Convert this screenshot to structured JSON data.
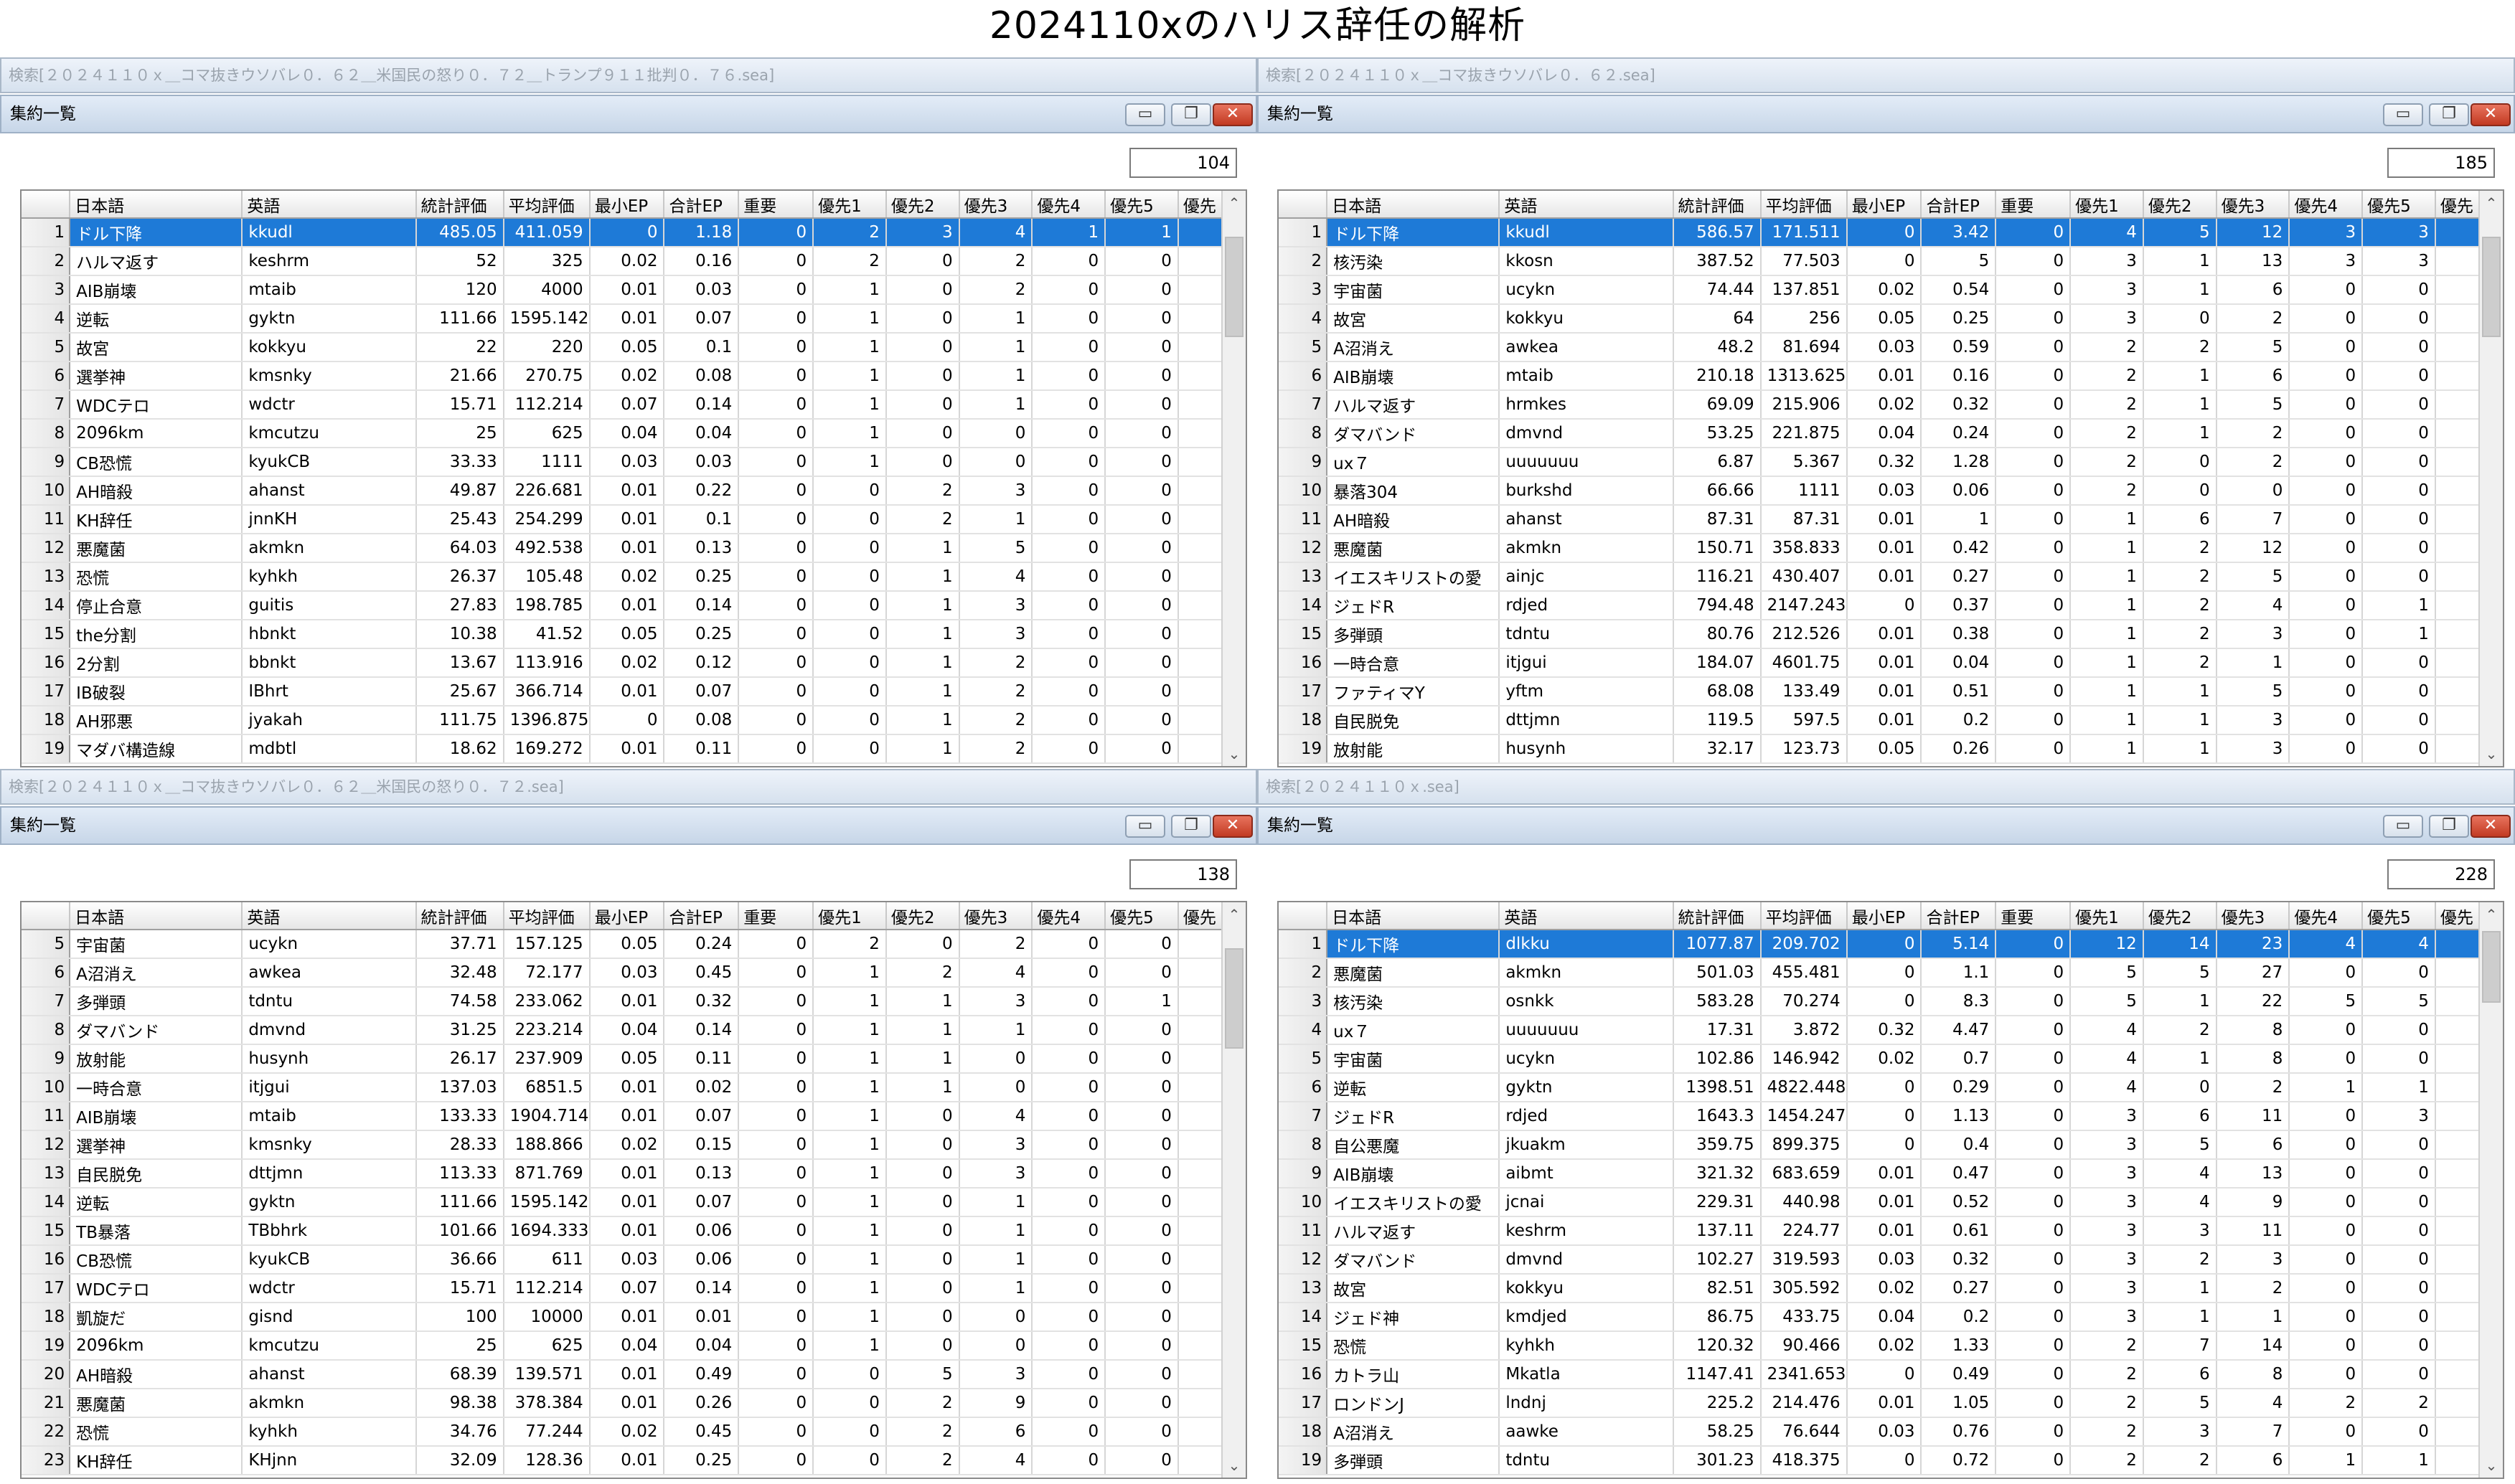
{
  "title": "2024110xのハリス辞任の解析",
  "columns": [
    "日本語",
    "英語",
    "統計評価",
    "平均評価",
    "最小EP",
    "合計EP",
    "重要",
    "優先1",
    "優先2",
    "優先3",
    "優先4",
    "優先5",
    "優先"
  ],
  "window_title": "集約一覧",
  "buttons": {
    "minimize": "▭",
    "restore": "❐",
    "close": "✕"
  },
  "scroll": {
    "up": "⌃",
    "down": "⌄"
  },
  "panes": [
    {
      "search": "検索[２０２４１１０ｘ＿コマ抜きウソバレ０．６２＿米国民の怒り０．７２＿トランプ９１１批判０．７６.sea]",
      "count": "104",
      "rows": [
        [
          "1",
          "ドル下降",
          "kkudl",
          "485.05",
          "411.059",
          "0",
          "1.18",
          "0",
          "2",
          "3",
          "4",
          "1",
          "1"
        ],
        [
          "2",
          "ハルマ返す",
          "keshrm",
          "52",
          "325",
          "0.02",
          "0.16",
          "0",
          "2",
          "0",
          "2",
          "0",
          "0"
        ],
        [
          "3",
          "AIB崩壊",
          "mtaib",
          "120",
          "4000",
          "0.01",
          "0.03",
          "0",
          "1",
          "0",
          "2",
          "0",
          "0"
        ],
        [
          "4",
          "逆転",
          "gyktn",
          "111.66",
          "1595.142",
          "0.01",
          "0.07",
          "0",
          "1",
          "0",
          "1",
          "0",
          "0"
        ],
        [
          "5",
          "故宮",
          "kokkyu",
          "22",
          "220",
          "0.05",
          "0.1",
          "0",
          "1",
          "0",
          "1",
          "0",
          "0"
        ],
        [
          "6",
          "選挙神",
          "kmsnky",
          "21.66",
          "270.75",
          "0.02",
          "0.08",
          "0",
          "1",
          "0",
          "1",
          "0",
          "0"
        ],
        [
          "7",
          "WDCテロ",
          "wdctr",
          "15.71",
          "112.214",
          "0.07",
          "0.14",
          "0",
          "1",
          "0",
          "1",
          "0",
          "0"
        ],
        [
          "8",
          "2096km",
          "kmcutzu",
          "25",
          "625",
          "0.04",
          "0.04",
          "0",
          "1",
          "0",
          "0",
          "0",
          "0"
        ],
        [
          "9",
          "CB恐慌",
          "kyukCB",
          "33.33",
          "1111",
          "0.03",
          "0.03",
          "0",
          "1",
          "0",
          "0",
          "0",
          "0"
        ],
        [
          "10",
          "AH暗殺",
          "ahanst",
          "49.87",
          "226.681",
          "0.01",
          "0.22",
          "0",
          "0",
          "2",
          "3",
          "0",
          "0"
        ],
        [
          "11",
          "KH辞任",
          "jnnKH",
          "25.43",
          "254.299",
          "0.01",
          "0.1",
          "0",
          "0",
          "2",
          "1",
          "0",
          "0"
        ],
        [
          "12",
          "悪魔菌",
          "akmkn",
          "64.03",
          "492.538",
          "0.01",
          "0.13",
          "0",
          "0",
          "1",
          "5",
          "0",
          "0"
        ],
        [
          "13",
          "恐慌",
          "kyhkh",
          "26.37",
          "105.48",
          "0.02",
          "0.25",
          "0",
          "0",
          "1",
          "4",
          "0",
          "0"
        ],
        [
          "14",
          "停止合意",
          "guitis",
          "27.83",
          "198.785",
          "0.01",
          "0.14",
          "0",
          "0",
          "1",
          "3",
          "0",
          "0"
        ],
        [
          "15",
          "the分割",
          "hbnkt",
          "10.38",
          "41.52",
          "0.05",
          "0.25",
          "0",
          "0",
          "1",
          "3",
          "0",
          "0"
        ],
        [
          "16",
          "2分割",
          "bbnkt",
          "13.67",
          "113.916",
          "0.02",
          "0.12",
          "0",
          "0",
          "1",
          "2",
          "0",
          "0"
        ],
        [
          "17",
          "IB破裂",
          "IBhrt",
          "25.67",
          "366.714",
          "0.01",
          "0.07",
          "0",
          "0",
          "1",
          "2",
          "0",
          "0"
        ],
        [
          "18",
          "AH邪悪",
          "jyakah",
          "111.75",
          "1396.875",
          "0",
          "0.08",
          "0",
          "0",
          "1",
          "2",
          "0",
          "0"
        ],
        [
          "19",
          "マダバ構造線",
          "mdbtl",
          "18.62",
          "169.272",
          "0.01",
          "0.11",
          "0",
          "0",
          "1",
          "2",
          "0",
          "0"
        ]
      ]
    },
    {
      "search": "検索[２０２４１１０ｘ＿コマ抜きウソバレ０．６２.sea]",
      "count": "185",
      "rows": [
        [
          "1",
          "ドル下降",
          "kkudl",
          "586.57",
          "171.511",
          "0",
          "3.42",
          "0",
          "4",
          "5",
          "12",
          "3",
          "3"
        ],
        [
          "2",
          "核汚染",
          "kkosn",
          "387.52",
          "77.503",
          "0",
          "5",
          "0",
          "3",
          "1",
          "13",
          "3",
          "3"
        ],
        [
          "3",
          "宇宙菌",
          "ucykn",
          "74.44",
          "137.851",
          "0.02",
          "0.54",
          "0",
          "3",
          "1",
          "6",
          "0",
          "0"
        ],
        [
          "4",
          "故宮",
          "kokkyu",
          "64",
          "256",
          "0.05",
          "0.25",
          "0",
          "3",
          "0",
          "2",
          "0",
          "0"
        ],
        [
          "5",
          "A沼消え",
          "awkea",
          "48.2",
          "81.694",
          "0.03",
          "0.59",
          "0",
          "2",
          "2",
          "5",
          "0",
          "0"
        ],
        [
          "6",
          "AIB崩壊",
          "mtaib",
          "210.18",
          "1313.625",
          "0.01",
          "0.16",
          "0",
          "2",
          "1",
          "6",
          "0",
          "0"
        ],
        [
          "7",
          "ハルマ返す",
          "hrmkes",
          "69.09",
          "215.906",
          "0.02",
          "0.32",
          "0",
          "2",
          "1",
          "5",
          "0",
          "0"
        ],
        [
          "8",
          "ダマバンド",
          "dmvnd",
          "53.25",
          "221.875",
          "0.04",
          "0.24",
          "0",
          "2",
          "1",
          "2",
          "0",
          "0"
        ],
        [
          "9",
          "ux７",
          "uuuuuuu",
          "6.87",
          "5.367",
          "0.32",
          "1.28",
          "0",
          "2",
          "0",
          "2",
          "0",
          "0"
        ],
        [
          "10",
          "暴落304",
          "burkshd",
          "66.66",
          "1111",
          "0.03",
          "0.06",
          "0",
          "2",
          "0",
          "0",
          "0",
          "0"
        ],
        [
          "11",
          "AH暗殺",
          "ahanst",
          "87.31",
          "87.31",
          "0.01",
          "1",
          "0",
          "1",
          "6",
          "7",
          "0",
          "0"
        ],
        [
          "12",
          "悪魔菌",
          "akmkn",
          "150.71",
          "358.833",
          "0.01",
          "0.42",
          "0",
          "1",
          "2",
          "12",
          "0",
          "0"
        ],
        [
          "13",
          "イエスキリストの愛",
          "ainjc",
          "116.21",
          "430.407",
          "0.01",
          "0.27",
          "0",
          "1",
          "2",
          "5",
          "0",
          "0"
        ],
        [
          "14",
          "ジェドR",
          "rdjed",
          "794.48",
          "2147.243",
          "0",
          "0.37",
          "0",
          "1",
          "2",
          "4",
          "0",
          "1"
        ],
        [
          "15",
          "多弾頭",
          "tdntu",
          "80.76",
          "212.526",
          "0.01",
          "0.38",
          "0",
          "1",
          "2",
          "3",
          "0",
          "1"
        ],
        [
          "16",
          "一時合意",
          "itjgui",
          "184.07",
          "4601.75",
          "0.01",
          "0.04",
          "0",
          "1",
          "2",
          "1",
          "0",
          "0"
        ],
        [
          "17",
          "ファティマY",
          "yftm",
          "68.08",
          "133.49",
          "0.01",
          "0.51",
          "0",
          "1",
          "1",
          "5",
          "0",
          "0"
        ],
        [
          "18",
          "自民脱免",
          "dttjmn",
          "119.5",
          "597.5",
          "0.01",
          "0.2",
          "0",
          "1",
          "1",
          "3",
          "0",
          "0"
        ],
        [
          "19",
          "放射能",
          "husynh",
          "32.17",
          "123.73",
          "0.05",
          "0.26",
          "0",
          "1",
          "1",
          "3",
          "0",
          "0"
        ]
      ]
    },
    {
      "search": "検索[２０２４１１０ｘ＿コマ抜きウソバレ０．６２＿米国民の怒り０．７２.sea]",
      "count": "138",
      "rows": [
        [
          "5",
          "宇宙菌",
          "ucykn",
          "37.71",
          "157.125",
          "0.05",
          "0.24",
          "0",
          "2",
          "0",
          "2",
          "0",
          "0"
        ],
        [
          "6",
          "A沼消え",
          "awkea",
          "32.48",
          "72.177",
          "0.03",
          "0.45",
          "0",
          "1",
          "2",
          "4",
          "0",
          "0"
        ],
        [
          "7",
          "多弾頭",
          "tdntu",
          "74.58",
          "233.062",
          "0.01",
          "0.32",
          "0",
          "1",
          "1",
          "3",
          "0",
          "1"
        ],
        [
          "8",
          "ダマバンド",
          "dmvnd",
          "31.25",
          "223.214",
          "0.04",
          "0.14",
          "0",
          "1",
          "1",
          "1",
          "0",
          "0"
        ],
        [
          "9",
          "放射能",
          "husynh",
          "26.17",
          "237.909",
          "0.05",
          "0.11",
          "0",
          "1",
          "1",
          "0",
          "0",
          "0"
        ],
        [
          "10",
          "一時合意",
          "itjgui",
          "137.03",
          "6851.5",
          "0.01",
          "0.02",
          "0",
          "1",
          "1",
          "0",
          "0",
          "0"
        ],
        [
          "11",
          "AIB崩壊",
          "mtaib",
          "133.33",
          "1904.714",
          "0.01",
          "0.07",
          "0",
          "1",
          "0",
          "4",
          "0",
          "0"
        ],
        [
          "12",
          "選挙神",
          "kmsnky",
          "28.33",
          "188.866",
          "0.02",
          "0.15",
          "0",
          "1",
          "0",
          "3",
          "0",
          "0"
        ],
        [
          "13",
          "自民脱免",
          "dttjmn",
          "113.33",
          "871.769",
          "0.01",
          "0.13",
          "0",
          "1",
          "0",
          "3",
          "0",
          "0"
        ],
        [
          "14",
          "逆転",
          "gyktn",
          "111.66",
          "1595.142",
          "0.01",
          "0.07",
          "0",
          "1",
          "0",
          "1",
          "0",
          "0"
        ],
        [
          "15",
          "TB暴落",
          "TBbhrk",
          "101.66",
          "1694.333",
          "0.01",
          "0.06",
          "0",
          "1",
          "0",
          "1",
          "0",
          "0"
        ],
        [
          "16",
          "CB恐慌",
          "kyukCB",
          "36.66",
          "611",
          "0.03",
          "0.06",
          "0",
          "1",
          "0",
          "1",
          "0",
          "0"
        ],
        [
          "17",
          "WDCテロ",
          "wdctr",
          "15.71",
          "112.214",
          "0.07",
          "0.14",
          "0",
          "1",
          "0",
          "1",
          "0",
          "0"
        ],
        [
          "18",
          "凱旋だ",
          "gisnd",
          "100",
          "10000",
          "0.01",
          "0.01",
          "0",
          "1",
          "0",
          "0",
          "0",
          "0"
        ],
        [
          "19",
          "2096km",
          "kmcutzu",
          "25",
          "625",
          "0.04",
          "0.04",
          "0",
          "1",
          "0",
          "0",
          "0",
          "0"
        ],
        [
          "20",
          "AH暗殺",
          "ahanst",
          "68.39",
          "139.571",
          "0.01",
          "0.49",
          "0",
          "0",
          "5",
          "3",
          "0",
          "0"
        ],
        [
          "21",
          "悪魔菌",
          "akmkn",
          "98.38",
          "378.384",
          "0.01",
          "0.26",
          "0",
          "0",
          "2",
          "9",
          "0",
          "0"
        ],
        [
          "22",
          "恐慌",
          "kyhkh",
          "34.76",
          "77.244",
          "0.02",
          "0.45",
          "0",
          "0",
          "2",
          "6",
          "0",
          "0"
        ],
        [
          "23",
          "KH辞任",
          "KHjnn",
          "32.09",
          "128.36",
          "0.01",
          "0.25",
          "0",
          "0",
          "2",
          "4",
          "0",
          "0"
        ]
      ]
    },
    {
      "search": "検索[２０２４１１０ｘ.sea]",
      "count": "228",
      "rows": [
        [
          "1",
          "ドル下降",
          "dlkku",
          "1077.87",
          "209.702",
          "0",
          "5.14",
          "0",
          "12",
          "14",
          "23",
          "4",
          "4"
        ],
        [
          "2",
          "悪魔菌",
          "akmkn",
          "501.03",
          "455.481",
          "0",
          "1.1",
          "0",
          "5",
          "5",
          "27",
          "0",
          "0"
        ],
        [
          "3",
          "核汚染",
          "osnkk",
          "583.28",
          "70.274",
          "0",
          "8.3",
          "0",
          "5",
          "1",
          "22",
          "5",
          "5"
        ],
        [
          "4",
          "ux７",
          "uuuuuuu",
          "17.31",
          "3.872",
          "0.32",
          "4.47",
          "0",
          "4",
          "2",
          "8",
          "0",
          "0"
        ],
        [
          "5",
          "宇宙菌",
          "ucykn",
          "102.86",
          "146.942",
          "0.02",
          "0.7",
          "0",
          "4",
          "1",
          "8",
          "0",
          "0"
        ],
        [
          "6",
          "逆転",
          "gyktn",
          "1398.51",
          "4822.448",
          "0",
          "0.29",
          "0",
          "4",
          "0",
          "2",
          "1",
          "1"
        ],
        [
          "7",
          "ジェドR",
          "rdjed",
          "1643.3",
          "1454.247",
          "0",
          "1.13",
          "0",
          "3",
          "6",
          "11",
          "0",
          "3"
        ],
        [
          "8",
          "自公悪魔",
          "jkuakm",
          "359.75",
          "899.375",
          "0",
          "0.4",
          "0",
          "3",
          "5",
          "6",
          "0",
          "0"
        ],
        [
          "9",
          "AIB崩壊",
          "aibmt",
          "321.32",
          "683.659",
          "0.01",
          "0.47",
          "0",
          "3",
          "4",
          "13",
          "0",
          "0"
        ],
        [
          "10",
          "イエスキリストの愛",
          "jcnai",
          "229.31",
          "440.98",
          "0.01",
          "0.52",
          "0",
          "3",
          "4",
          "9",
          "0",
          "0"
        ],
        [
          "11",
          "ハルマ返す",
          "keshrm",
          "137.11",
          "224.77",
          "0.01",
          "0.61",
          "0",
          "3",
          "3",
          "11",
          "0",
          "0"
        ],
        [
          "12",
          "ダマバンド",
          "dmvnd",
          "102.27",
          "319.593",
          "0.03",
          "0.32",
          "0",
          "3",
          "2",
          "3",
          "0",
          "0"
        ],
        [
          "13",
          "故宮",
          "kokkyu",
          "82.51",
          "305.592",
          "0.02",
          "0.27",
          "0",
          "3",
          "1",
          "2",
          "0",
          "0"
        ],
        [
          "14",
          "ジェド神",
          "kmdjed",
          "86.75",
          "433.75",
          "0.04",
          "0.2",
          "0",
          "3",
          "1",
          "1",
          "0",
          "0"
        ],
        [
          "15",
          "恐慌",
          "kyhkh",
          "120.32",
          "90.466",
          "0.02",
          "1.33",
          "0",
          "2",
          "7",
          "14",
          "0",
          "0"
        ],
        [
          "16",
          "カトラ山",
          "Mkatla",
          "1147.41",
          "2341.653",
          "0",
          "0.49",
          "0",
          "2",
          "6",
          "8",
          "0",
          "0"
        ],
        [
          "17",
          "ロンドンJ",
          "lndnj",
          "225.2",
          "214.476",
          "0.01",
          "1.05",
          "0",
          "2",
          "5",
          "4",
          "2",
          "2"
        ],
        [
          "18",
          "A沼消え",
          "aawke",
          "58.25",
          "76.644",
          "0.03",
          "0.76",
          "0",
          "2",
          "3",
          "7",
          "0",
          "0"
        ],
        [
          "19",
          "多弾頭",
          "tdntu",
          "301.23",
          "418.375",
          "0",
          "0.72",
          "0",
          "2",
          "2",
          "6",
          "1",
          "1"
        ]
      ]
    }
  ]
}
